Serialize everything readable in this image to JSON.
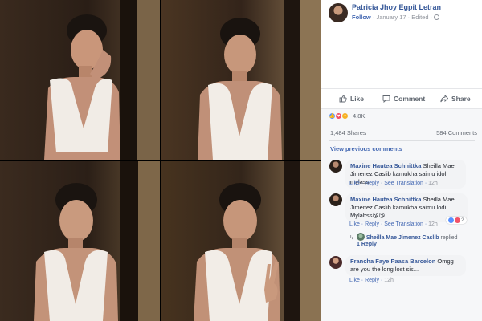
{
  "post": {
    "author": "Patricia Jhoy Egpit Letran",
    "follow_label": "Follow",
    "date": "January 17",
    "edited_label": "Edited"
  },
  "actions": {
    "like": "Like",
    "comment": "Comment",
    "share": "Share"
  },
  "reactions": {
    "count": "4.8K",
    "types": [
      "like",
      "love",
      "wow"
    ]
  },
  "stats": {
    "shares": "1,484 Shares",
    "comments": "584 Comments"
  },
  "view_previous": "View previous comments",
  "comments": [
    {
      "name": "Maxine Hautea Schnittka",
      "text": "Sheilla Mae Jimenez Caslib kamukha saimu idol mylass",
      "actions": {
        "like": "Like",
        "reply": "Reply",
        "translate": "See Translation",
        "time": "12h"
      }
    },
    {
      "name": "Maxine Hautea Schnittka",
      "text": "Sheilla Mae Jimenez Caslib kamukha saimu lodi Mylabss😘😘",
      "actions": {
        "like": "Like",
        "reply": "Reply",
        "translate": "See Translation",
        "time": "12h"
      },
      "reaction_count": "2",
      "reply": {
        "name": "Sheilla Mae Jimenez Caslib",
        "replied": "replied",
        "dot": "·",
        "count": "1 Reply"
      }
    },
    {
      "name": "Francha Faye Paasa Barcelon",
      "text": "Omgg are you the long lost sis...",
      "actions": {
        "like": "Like",
        "reply": "Reply",
        "time": "12h"
      }
    }
  ],
  "colors": {
    "link": "#365899",
    "action_blue": "#4267b2",
    "meta_gray": "#90949c",
    "panel_bg": "#f6f7f9"
  }
}
